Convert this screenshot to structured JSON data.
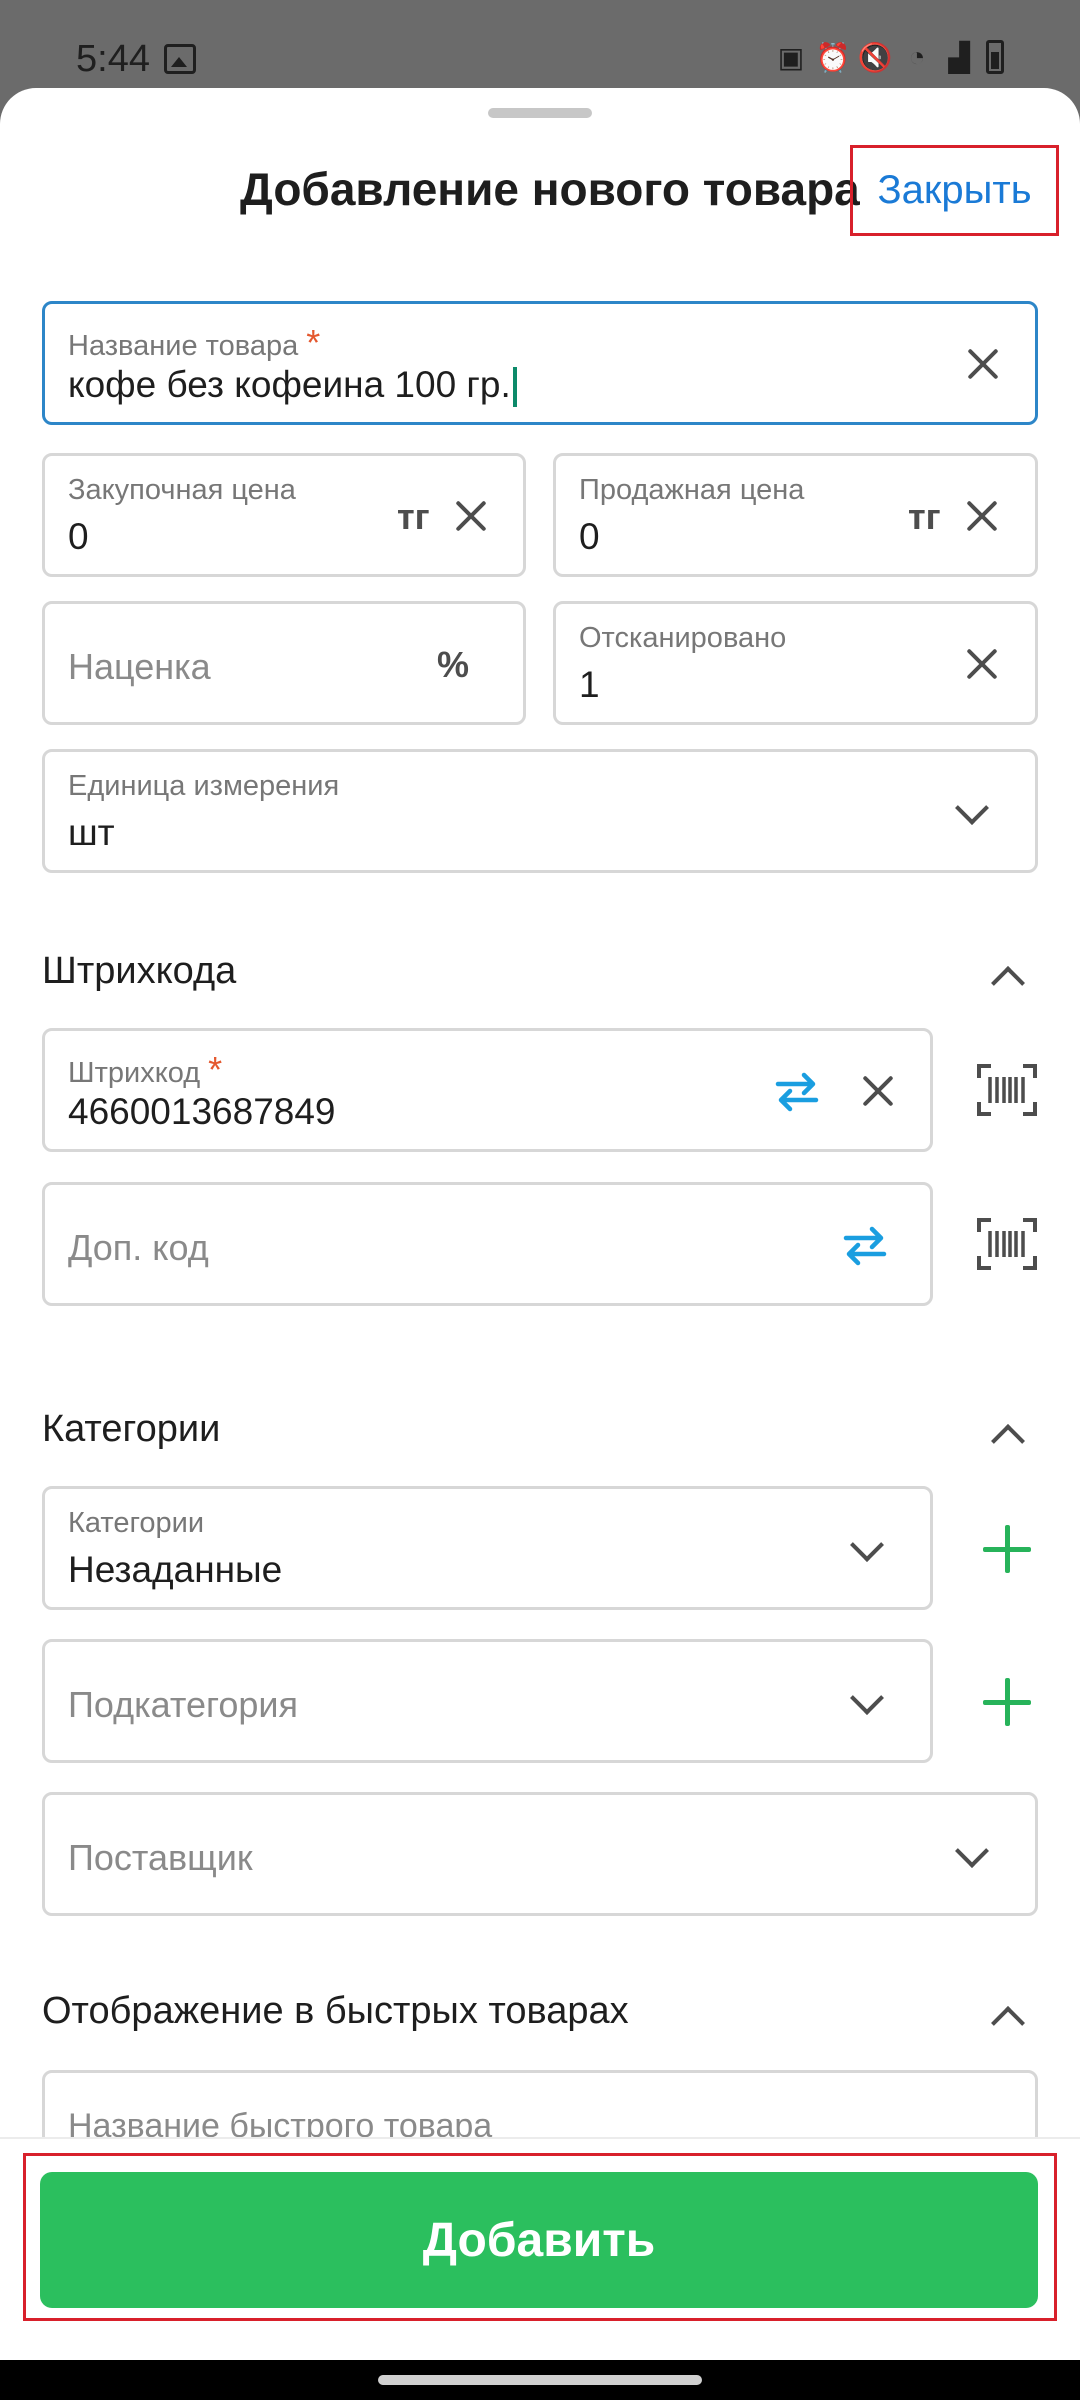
{
  "status": {
    "time": "5:44"
  },
  "header": {
    "title": "Добавление нового товара",
    "close_label": "Закрыть"
  },
  "fields": {
    "name": {
      "label": "Название товара",
      "required": "*",
      "value": "кофе без кофеина 100 гр."
    },
    "purchase_price": {
      "label": "Закупочная цена",
      "value": "0",
      "unit": "тг"
    },
    "sale_price": {
      "label": "Продажная цена",
      "value": "0",
      "unit": "тг"
    },
    "markup": {
      "placeholder": "Наценка",
      "unit": "%"
    },
    "scanned": {
      "label": "Отсканировано",
      "value": "1"
    },
    "unit": {
      "label": "Единица измерения",
      "value": "шт"
    }
  },
  "barcodes": {
    "section_title": "Штрихкода",
    "barcode": {
      "label": "Штрихкод",
      "required": "*",
      "value": "4660013687849"
    },
    "extra_code": {
      "placeholder": "Доп. код"
    }
  },
  "categories": {
    "section_title": "Категории",
    "category": {
      "label": "Категории",
      "value": "Незаданные"
    },
    "subcategory": {
      "placeholder": "Подкатегория"
    },
    "supplier": {
      "placeholder": "Поставщик"
    }
  },
  "quick_items": {
    "section_title": "Отображение в быстрых товарах",
    "name": {
      "placeholder": "Название быстрого товара"
    }
  },
  "footer": {
    "add_label": "Добавить"
  },
  "colors": {
    "accent_blue": "#1a7ad6",
    "green": "#2bbf5e",
    "highlight_red": "#d8202b"
  }
}
